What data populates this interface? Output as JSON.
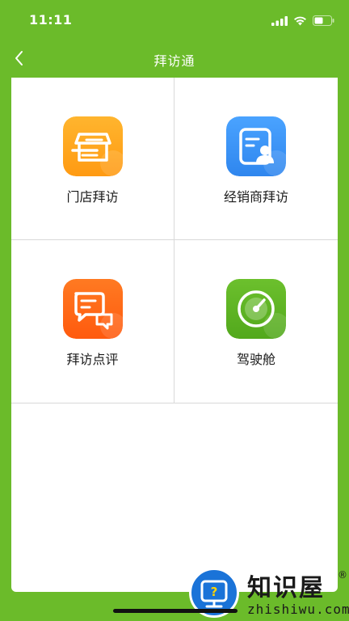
{
  "status": {
    "time": "11:11"
  },
  "nav": {
    "title": "拜访通",
    "back_icon": "chevron-left-icon"
  },
  "tiles": [
    {
      "label": "门店拜访",
      "icon": "storefront-icon",
      "color": "#ffa21a"
    },
    {
      "label": "经销商拜访",
      "icon": "dealer-card-icon",
      "color": "#3d94f5"
    },
    {
      "label": "拜访点评",
      "icon": "comment-icon",
      "color": "#ff6a1a"
    },
    {
      "label": "驾驶舱",
      "icon": "gauge-icon",
      "color": "#5fb524"
    }
  ],
  "colors": {
    "header_bg": "#6bbb2a",
    "card_bg": "#ffffff",
    "divider": "#d9d9d9"
  },
  "watermark": {
    "title": "知识屋",
    "reg": "®",
    "url": "zhishiwu.com"
  }
}
